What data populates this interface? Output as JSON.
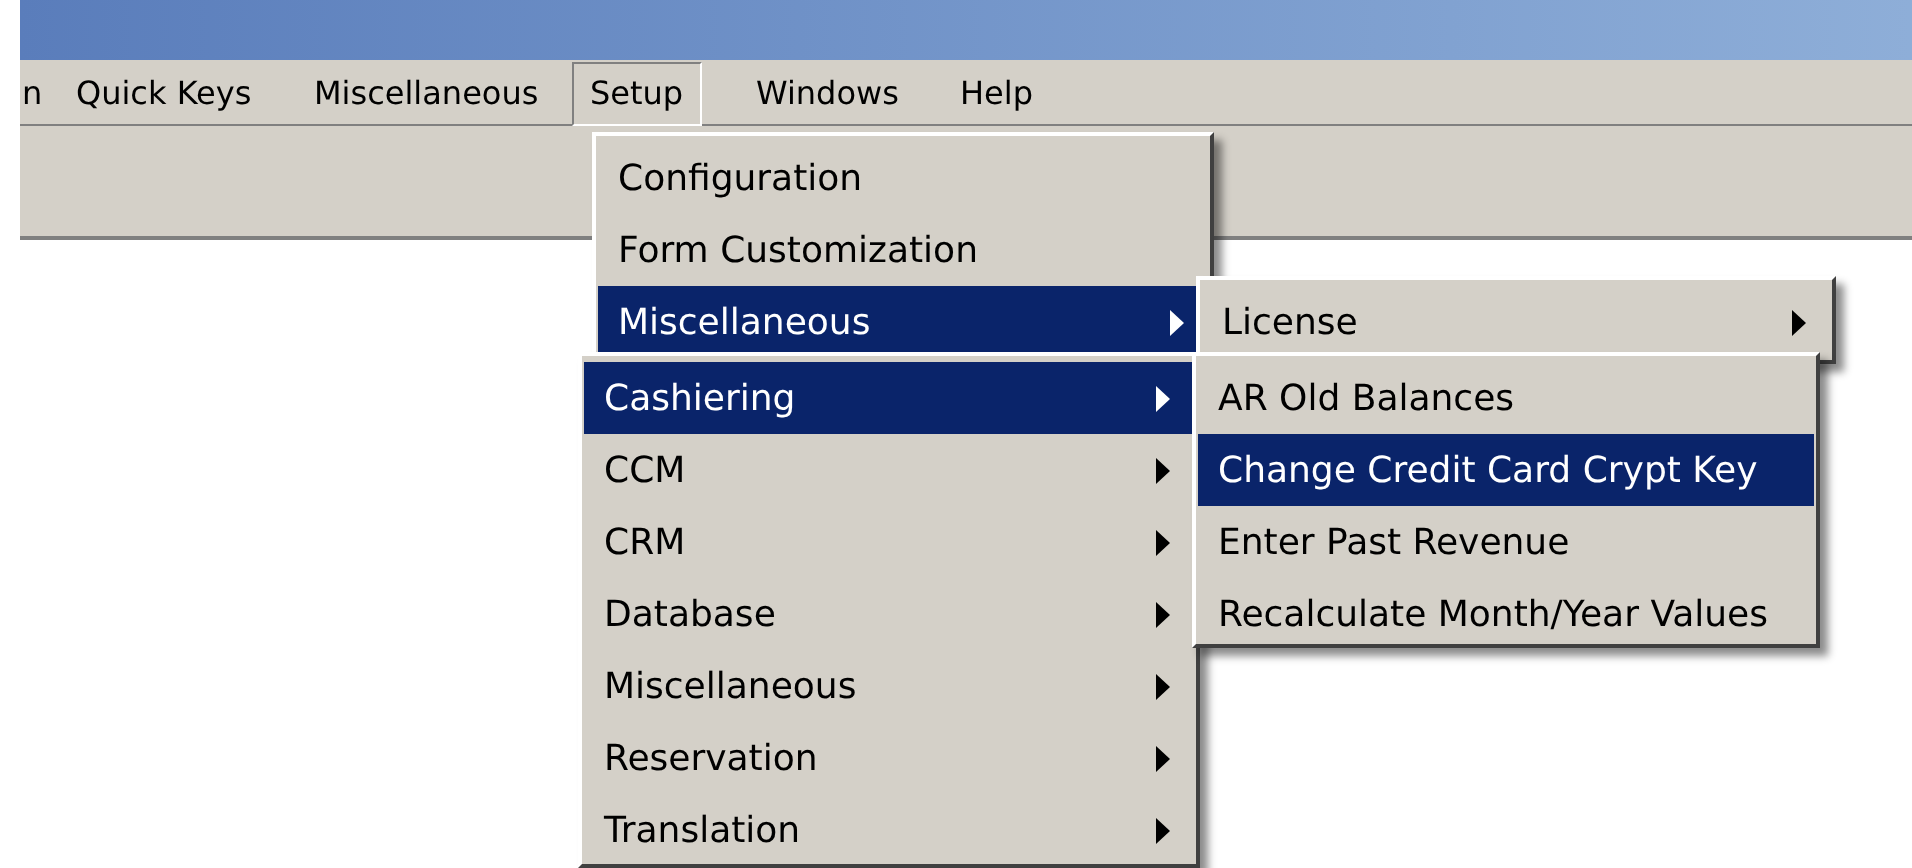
{
  "menu_bar": {
    "items": [
      {
        "label": "n",
        "selected": false
      },
      {
        "label": "Quick Keys",
        "selected": false
      },
      {
        "label": "Miscellaneous",
        "selected": false
      },
      {
        "label": "Setup",
        "selected": true
      },
      {
        "label": "Windows",
        "selected": false
      },
      {
        "label": "Help",
        "selected": false
      }
    ]
  },
  "menus": [
    {
      "items": [
        {
          "label": "Configuration",
          "selected": false,
          "has_submenu": false
        },
        {
          "label": "Form Customization",
          "selected": false,
          "has_submenu": false
        },
        {
          "label": "Miscellaneous",
          "selected": true,
          "has_submenu": true
        }
      ]
    },
    {
      "items": [
        {
          "label": "License",
          "selected": false,
          "has_submenu": true
        }
      ]
    },
    {
      "items": [
        {
          "label": "Cashiering",
          "selected": true,
          "has_submenu": true
        },
        {
          "label": "CCM",
          "selected": false,
          "has_submenu": true
        },
        {
          "label": "CRM",
          "selected": false,
          "has_submenu": true
        },
        {
          "label": "Database",
          "selected": false,
          "has_submenu": true
        },
        {
          "label": "Miscellaneous",
          "selected": false,
          "has_submenu": true
        },
        {
          "label": "Reservation",
          "selected": false,
          "has_submenu": true
        },
        {
          "label": "Translation",
          "selected": false,
          "has_submenu": true
        }
      ]
    },
    {
      "items": [
        {
          "label": "AR Old Balances",
          "selected": false,
          "has_submenu": false
        },
        {
          "label": "Change Credit Card Crypt Key",
          "selected": true,
          "has_submenu": false
        },
        {
          "label": "Enter Past Revenue",
          "selected": false,
          "has_submenu": false
        },
        {
          "label": "Recalculate Month/Year Values",
          "selected": false,
          "has_submenu": false
        }
      ]
    }
  ]
}
